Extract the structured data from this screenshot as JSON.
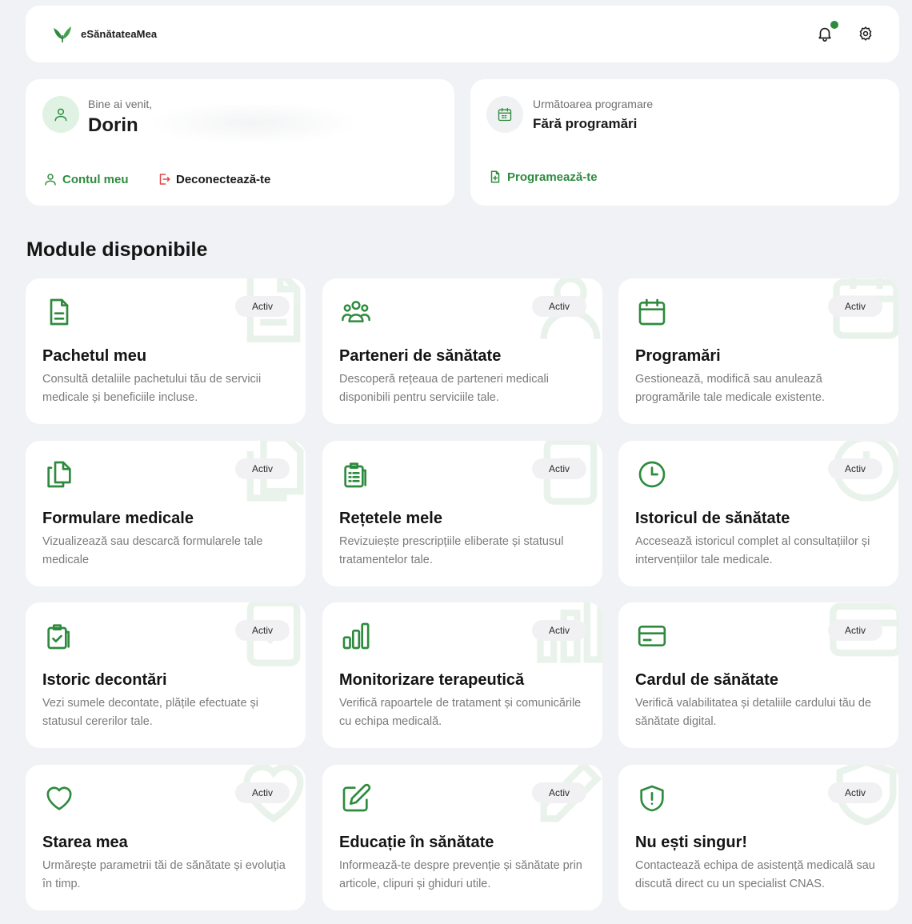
{
  "header": {
    "app_name": "eSănătateaMea",
    "notification_icon": "bell-icon",
    "settings_icon": "gear-icon"
  },
  "welcome": {
    "greeting": "Bine ai venit,",
    "user_name": "Dorin",
    "account_link": "Contul meu",
    "logout_link": "Deconectează-te"
  },
  "appointment": {
    "label": "Următoarea programare",
    "value": "Fără programări",
    "book_link": "Programează-te"
  },
  "section_title": "Module disponibile",
  "colors": {
    "accent": "#2e8b3e",
    "background": "#f1f2f5",
    "card": "#ffffff"
  },
  "modules": [
    {
      "icon": "document-icon",
      "badge": "Activ",
      "title": "Pachetul meu",
      "description": "Consultă detaliile pachetului tău de servicii medicale și beneficiile incluse."
    },
    {
      "icon": "people-icon",
      "badge": "Activ",
      "title": "Parteneri de sănătate",
      "description": "Descoperă rețeaua de parteneri medicali disponibili pentru serviciile tale."
    },
    {
      "icon": "calendar-icon",
      "badge": "Activ",
      "title": "Programări",
      "description": "Gestionează, modifică sau anulează programările tale medicale existente."
    },
    {
      "icon": "files-icon",
      "badge": "Activ",
      "title": "Formulare medicale",
      "description": "Vizualizează sau descarcă formularele tale medicale"
    },
    {
      "icon": "clipboard-list-icon",
      "badge": "Activ",
      "title": "Rețetele mele",
      "description": "Revizuiește prescripțiile eliberate și statusul tratamentelor tale."
    },
    {
      "icon": "clock-icon",
      "badge": "Activ",
      "title": "Istoricul de sănătate",
      "description": "Accesează istoricul complet al consultațiilor și intervențiilor tale medicale."
    },
    {
      "icon": "clipboard-check-icon",
      "badge": "Activ",
      "title": "Istoric decontări",
      "description": "Vezi sumele decontate, plățile efectuate și statusul cererilor tale."
    },
    {
      "icon": "bar-chart-icon",
      "badge": "Activ",
      "title": "Monitorizare terapeutică",
      "description": "Verifică rapoartele de tratament și comunicările cu echipa medicală."
    },
    {
      "icon": "credit-card-icon",
      "badge": "Activ",
      "title": "Cardul de sănătate",
      "description": "Verifică valabilitatea și detaliile cardului tău de sănătate digital."
    },
    {
      "icon": "heart-icon",
      "badge": "Activ",
      "title": "Starea mea",
      "description": "Urmărește parametrii tăi de sănătate și evoluția în timp."
    },
    {
      "icon": "pencil-square-icon",
      "badge": "Activ",
      "title": "Educație în sănătate",
      "description": "Informează-te despre prevenție și sănătate prin articole, clipuri și ghiduri utile."
    },
    {
      "icon": "shield-alert-icon",
      "badge": "Activ",
      "title": "Nu ești singur!",
      "description": "Contactează echipa de asistență medicală sau discută direct cu un specialist CNAS."
    }
  ]
}
